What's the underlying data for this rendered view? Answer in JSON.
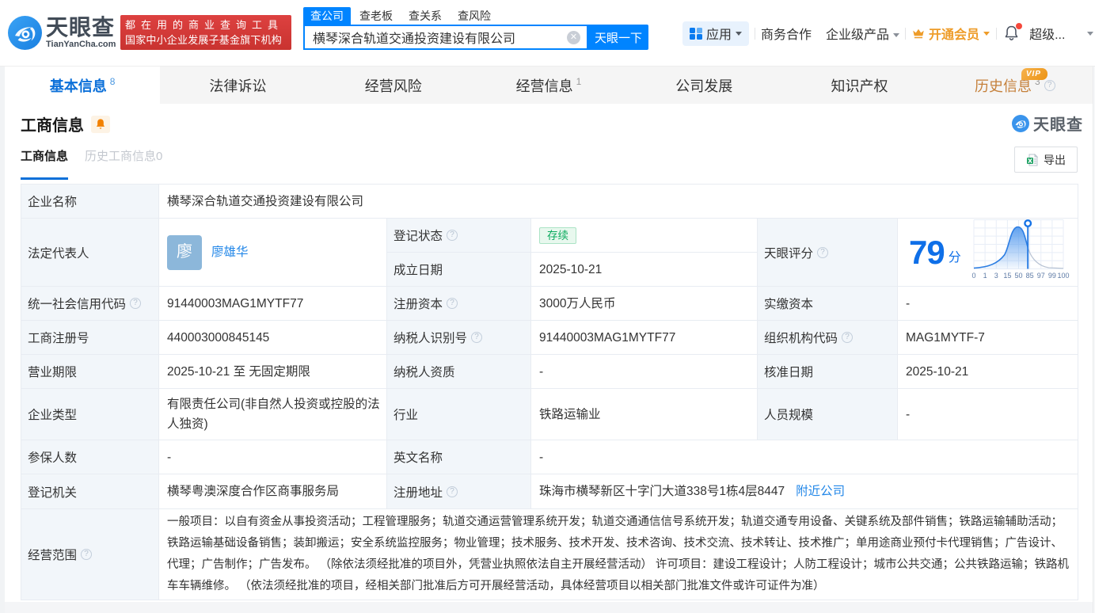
{
  "brand": {
    "name": "天眼查",
    "domain": "TianYanCha.com",
    "slogan_line1": "都在用的商业查询工具",
    "slogan_line2": "国家中小企业发展子基金旗下机构"
  },
  "search": {
    "tabs": [
      {
        "label": "查公司",
        "active": true
      },
      {
        "label": "查老板",
        "active": false
      },
      {
        "label": "查关系",
        "active": false
      },
      {
        "label": "查风险",
        "active": false
      }
    ],
    "value": "横琴深合轨道交通投资建设有限公司",
    "button_label": "天眼一下"
  },
  "header_menu": {
    "app": "应用",
    "business": "商务合作",
    "enterprise": "企业级产品",
    "vip": "开通会员",
    "user": "超级..."
  },
  "nav_tabs": [
    {
      "label": "基本信息",
      "count": "8"
    },
    {
      "label": "法律诉讼",
      "count": ""
    },
    {
      "label": "经营风险",
      "count": ""
    },
    {
      "label": "经营信息",
      "count": "1"
    },
    {
      "label": "公司发展",
      "count": ""
    },
    {
      "label": "知识产权",
      "count": ""
    },
    {
      "label": "历史信息",
      "count": "3",
      "vip_badge": "VIP"
    }
  ],
  "section": {
    "title": "工商信息",
    "watermark": "天眼查",
    "subtab_active": "工商信息",
    "subtab_inactive": "历史工商信息0",
    "export_label": "导出"
  },
  "fields": {
    "company_name": {
      "label": "企业名称",
      "value": "横琴深合轨道交通投资建设有限公司"
    },
    "legal_rep": {
      "label": "法定代表人",
      "name": "廖雄华",
      "avatar_char": "廖"
    },
    "reg_status": {
      "label": "登记状态",
      "value": "存续"
    },
    "establish_date": {
      "label": "成立日期",
      "value": "2025-10-21"
    },
    "tyc_score": {
      "label": "天眼评分",
      "score": "79",
      "unit": "分"
    },
    "credit_code": {
      "label": "统一社会信用代码",
      "value": "91440003MAG1MYTF77"
    },
    "reg_capital": {
      "label": "注册资本",
      "value": "3000万人民币"
    },
    "paid_capital": {
      "label": "实缴资本",
      "value": "-"
    },
    "reg_number": {
      "label": "工商注册号",
      "value": "440003000845145"
    },
    "taxpayer_id": {
      "label": "纳税人识别号",
      "value": "91440003MAG1MYTF77"
    },
    "org_code": {
      "label": "组织机构代码",
      "value": "MAG1MYTF-7"
    },
    "business_term": {
      "label": "营业期限",
      "value": "2025-10-21 至 无固定期限"
    },
    "taxpayer_quality": {
      "label": "纳税人资质",
      "value": "-"
    },
    "approval_date": {
      "label": "核准日期",
      "value": "2025-10-21"
    },
    "company_type": {
      "label": "企业类型",
      "value": "有限责任公司(非自然人投资或控股的法人独资)"
    },
    "industry": {
      "label": "行业",
      "value": "铁路运输业"
    },
    "staff_size": {
      "label": "人员规模",
      "value": "-"
    },
    "insured_count": {
      "label": "参保人数",
      "value": "-"
    },
    "english_name": {
      "label": "英文名称",
      "value": "-"
    },
    "reg_authority": {
      "label": "登记机关",
      "value": "横琴粤澳深度合作区商事服务局"
    },
    "reg_address": {
      "label": "注册地址",
      "value": "珠海市横琴新区十字门大道338号1栋4层8447",
      "link": "附近公司"
    },
    "business_scope": {
      "label": "经营范围",
      "value": "一般项目：以自有资金从事投资活动；工程管理服务；轨道交通运营管理系统开发；轨道交通通信信号系统开发；轨道交通专用设备、关键系统及部件销售；铁路运输辅助活动；铁路运输基础设备销售；装卸搬运；安全系统监控服务；物业管理；技术服务、技术开发、技术咨询、技术交流、技术转让、技术推广；单用途商业预付卡代理销售；广告设计、代理；广告制作；广告发布。 （除依法须经批准的项目外，凭营业执照依法自主开展经营活动） 许可项目：建设工程设计；人防工程设计；城市公共交通；公共铁路运输；铁路机车车辆维修。 （依法须经批准的项目，经相关部门批准后方可开展经营活动，具体经营项目以相关部门批准文件或许可证件为准）"
    }
  },
  "chart_data": {
    "type": "area",
    "title": "天眼评分",
    "score": 79,
    "unit": "分",
    "x_ticks": [
      0,
      1,
      3,
      15,
      50,
      85,
      97,
      99,
      100
    ],
    "curve_peak_tick": 50,
    "grid": true,
    "accent_color": "#2b7de3"
  }
}
